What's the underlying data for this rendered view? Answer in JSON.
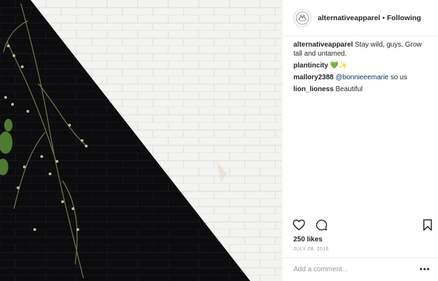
{
  "post": {
    "image": {
      "description_icon": "photo"
    },
    "header": {
      "username": "alternativeapparel",
      "separator": "•",
      "follow_label": "Following",
      "avatar_icon": "brand-logo-icon"
    },
    "comments": [
      {
        "user": "alternativeapparel",
        "text": "Stay wild, guys. Grow tall and untamed."
      },
      {
        "user": "plantincity",
        "text": "",
        "emoji": "💚✨"
      },
      {
        "user": "mallory2388",
        "mention": "@bonnieeemarie",
        "text": " so us"
      },
      {
        "user": "lion_lioness",
        "text": "Beautiful"
      }
    ],
    "actions": {
      "like_icon": "heart-icon",
      "comment_icon": "comment-icon",
      "save_icon": "bookmark-icon"
    },
    "likes": "250 likes",
    "date": "JULY 28, 2016",
    "add_comment_placeholder": "Add a comment...",
    "more_label": "•••"
  }
}
